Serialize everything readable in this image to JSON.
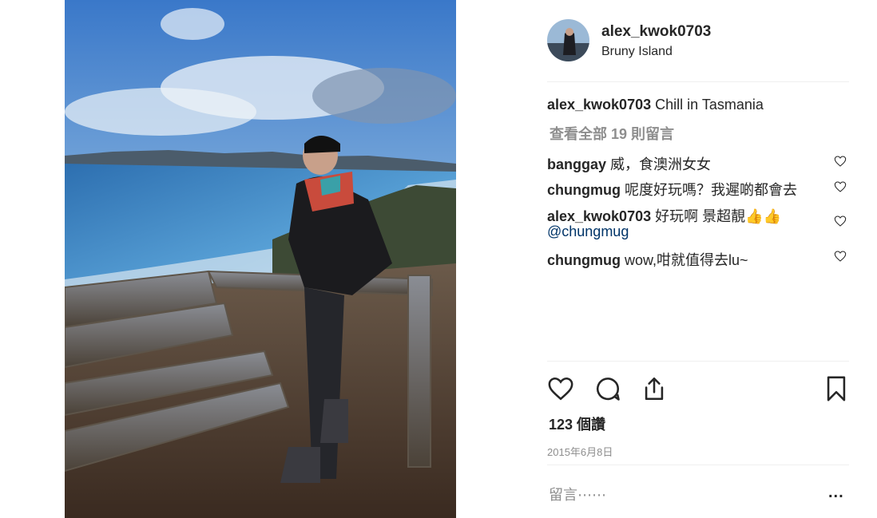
{
  "post": {
    "username": "alex_kwok0703",
    "location": "Bruny Island",
    "caption": "Chill in Tasmania",
    "view_all_comments": "查看全部 19 則留言",
    "comments": [
      {
        "user": "banggay",
        "text": "威，食澳洲女女"
      },
      {
        "user": "chungmug",
        "text": "呢度好玩嗎？我遲啲都會去"
      },
      {
        "user": "alex_kwok0703",
        "text": "好玩啊 景超靚👍👍",
        "mention": "@chungmug"
      },
      {
        "user": "chungmug",
        "text": "wow,咁就值得去lu~"
      }
    ],
    "likes": "123 個讚",
    "date": "2015年6月8日",
    "add_comment_placeholder": "留言⋯⋯",
    "more_label": "..."
  },
  "icons": {
    "like": "heart-icon",
    "comment": "comment-bubble-icon",
    "share": "share-upload-icon",
    "save": "bookmark-icon",
    "comment_like": "small-heart-icon"
  },
  "colors": {
    "text": "#262626",
    "secondary": "#8e8e8e",
    "mention": "#003569",
    "divider": "#efefef"
  }
}
